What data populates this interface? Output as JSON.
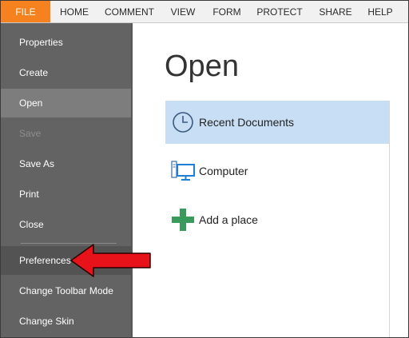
{
  "ribbon": {
    "tabs": [
      {
        "label": "FILE"
      },
      {
        "label": "HOME"
      },
      {
        "label": "COMMENT"
      },
      {
        "label": "VIEW"
      },
      {
        "label": "FORM"
      },
      {
        "label": "PROTECT"
      },
      {
        "label": "SHARE"
      },
      {
        "label": "HELP"
      }
    ],
    "active_color": "#f6821f"
  },
  "sidebar": {
    "items": [
      {
        "label": "Properties"
      },
      {
        "label": "Create"
      },
      {
        "label": "Open",
        "state": "active"
      },
      {
        "label": "Save",
        "state": "disabled"
      },
      {
        "label": "Save As"
      },
      {
        "label": "Print"
      },
      {
        "label": "Close"
      },
      {
        "label": "Preferences",
        "state": "highlighted"
      },
      {
        "label": "Change Toolbar Mode"
      },
      {
        "label": "Change Skin"
      }
    ],
    "background": "#636363"
  },
  "main": {
    "title": "Open",
    "places": [
      {
        "label": "Recent Documents",
        "icon": "clock-icon",
        "selected": true
      },
      {
        "label": "Computer",
        "icon": "computer-icon",
        "selected": false
      },
      {
        "label": "Add a place",
        "icon": "plus-icon",
        "selected": false
      }
    ],
    "selected_color": "#c7def4"
  },
  "annotation": {
    "icon": "red-arrow-icon",
    "color": "#e8121b"
  }
}
